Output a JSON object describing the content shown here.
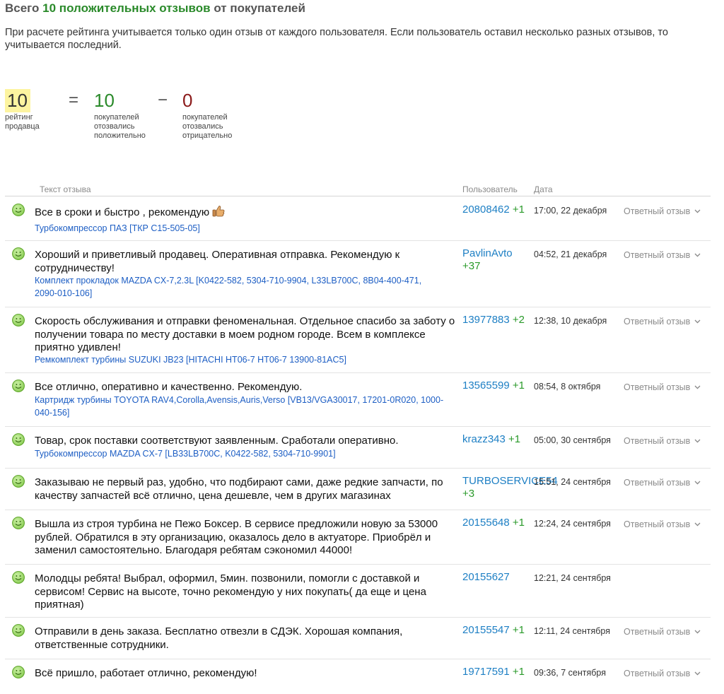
{
  "header": {
    "title_prefix": "Всего",
    "title_highlight": "10 положительных отзывов",
    "title_suffix": "от покупателей",
    "note": "При расчете рейтинга учитывается только один отзыв от каждого пользователя. Если пользователь оставил несколько разных отзывов, то учитывается последний."
  },
  "summary": {
    "rating": {
      "value": "10",
      "label": "рейтинг продавца"
    },
    "equals": "=",
    "positive": {
      "value": "10",
      "label": "покупателей отозвались положительно"
    },
    "minus": "−",
    "negative": {
      "value": "0",
      "label": "покупателей отозвались отрицательно"
    }
  },
  "table": {
    "col_text": "Текст отзыва",
    "col_user": "Пользователь",
    "col_date": "Дата",
    "reply_label": "Ответный отзыв"
  },
  "reviews": [
    {
      "text": "Все в сроки и быстро , рекомендую",
      "product": "Турбокомпрессор ПАЗ [ТКР С15-505-05]",
      "user": "20808462",
      "score": "+1",
      "date": "17:00, 22 декабря",
      "reply": "Ответный отзыв"
    },
    {
      "text": "Хороший и приветливый продавец. Оперативная отправка. Рекомендую к сотрудничеству!",
      "product": "Комплект прокладок MAZDA CX-7,2.3L [K0422-582, 5304-710-9904, L33LB700C, 8B04-400-471, 2090-010-106]",
      "user": "PavlinAvto",
      "score": "+37",
      "date": "04:52, 21 декабря",
      "reply": "Ответный отзыв"
    },
    {
      "text": "Скорость обслуживания и отправки феноменальная. Отдельное спасибо за заботу о получении товара по месту доставки в моем родном городе. Всем в комплексе приятно удивлен!",
      "product": "Ремкомплект турбины SUZUKI JB23 [HITACHI HT06-7 HT06-7 13900-81AC5]",
      "user": "13977883",
      "score": "+2",
      "date": "12:38, 10 декабря",
      "reply": "Ответный отзыв"
    },
    {
      "text": "Все отлично, оперативно и качественно. Рекомендую.",
      "product": "Картридж турбины TOYOTA RAV4,Corolla,Avensis,Auris,Verso [VB13/VGA30017, 17201-0R020, 1000-040-156]",
      "user": "13565599",
      "score": "+1",
      "date": "08:54, 8 октября",
      "reply": "Ответный отзыв"
    },
    {
      "text": "Товар, срок поставки соответствуют заявленным. Сработали оперативно.",
      "product": "Турбокомпрессор MAZDA CX-7 [LB33LB700C, K0422-582, 5304-710-9901]",
      "user": "krazz343",
      "score": "+1",
      "date": "05:00, 30 сентября",
      "reply": "Ответный отзыв"
    },
    {
      "text": "Заказываю не первый раз, удобно, что подбирают сами, даже редкие запчасти, по качеству запчастей всё отлично, цена дешевле, чем в других магазинах",
      "product": "",
      "user": "TURBOSERVICE54",
      "score": "+3",
      "date": "15:51, 24 сентября",
      "reply": "Ответный отзыв"
    },
    {
      "text": "Вышла из строя турбина не Пежо Боксер. В сервисе предложили новую за 53000 рублей. Обратился в эту организацию, оказалось дело в актуаторе. Приобрёл и заменил самостоятельно. Благодаря ребятам сэкономил 44000!",
      "product": "",
      "user": "20155648",
      "score": "+1",
      "date": "12:24, 24 сентября",
      "reply": "Ответный отзыв"
    },
    {
      "text": "Молодцы ребята! Выбрал, оформил, 5мин. позвонили, помогли с доставкой и сервисом! Сервис на высоте, точно рекомендую у них покупать( да еще и цена приятная)",
      "product": "",
      "user": "20155627",
      "score": "",
      "date": "12:21, 24 сентября",
      "reply": ""
    },
    {
      "text": "Отправили в день заказа. Бесплатно отвезли в СДЭК. Хорошая компания, ответственные сотрудники.",
      "product": "",
      "user": "20155547",
      "score": "+1",
      "date": "12:11, 24 сентября",
      "reply": "Ответный отзыв"
    },
    {
      "text": "Всё пришло, работает отлично, рекомендую!",
      "product": "",
      "user": "19717591",
      "score": "+1",
      "date": "09:36, 7 сентября",
      "reply": "Ответный отзыв"
    }
  ]
}
